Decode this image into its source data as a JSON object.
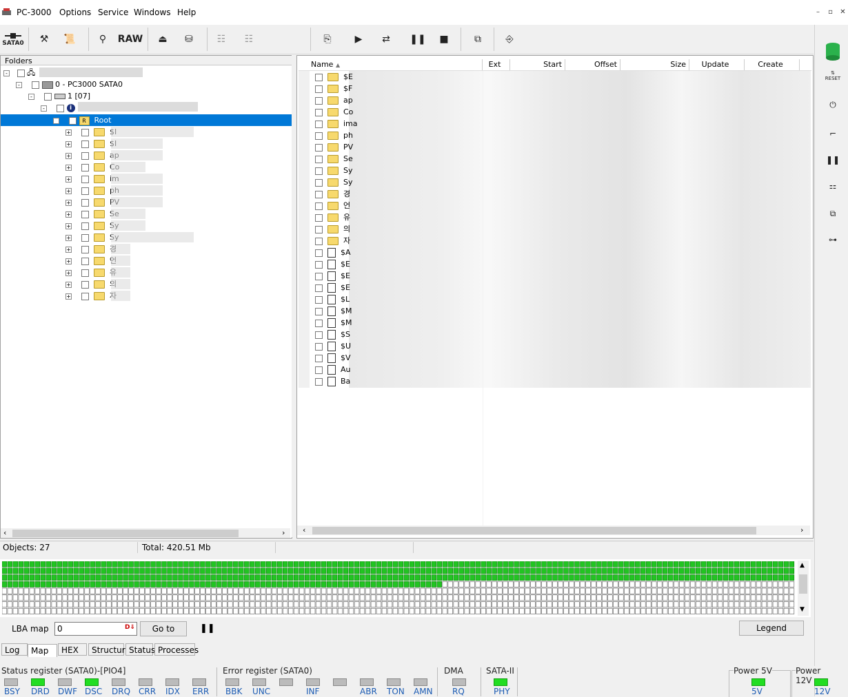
{
  "app": {
    "title": "PC-3000",
    "menu": [
      "Options",
      "Service",
      "Windows",
      "Help"
    ]
  },
  "toolbar": {
    "sata_label": "SATA0",
    "raw_label": "RAW"
  },
  "folders": {
    "header": "Folders",
    "tree": [
      {
        "label": "0 - PC3000 SATA0"
      },
      {
        "label": "1 [07]"
      },
      {
        "label": "Root"
      }
    ],
    "children": [
      "$I",
      "$I",
      "ap",
      "Co",
      "im",
      "ph",
      "PV",
      "Se",
      "Sy",
      "Sy",
      "경",
      "언",
      "유",
      "의",
      "자"
    ]
  },
  "filelist": {
    "columns": [
      "Name",
      "Ext",
      "Start",
      "Offset",
      "Size",
      "Update",
      "Create"
    ],
    "folders": [
      "$E",
      "$F",
      "ap",
      "Co",
      "ima",
      "ph",
      "PV",
      "Se",
      "Sy",
      "Sy",
      "경",
      "언",
      "유",
      "의",
      "자"
    ],
    "files": [
      "$A",
      "$E",
      "$E",
      "$E",
      "$L",
      "$M",
      "$M",
      "$S",
      "$U",
      "$V",
      "Au",
      "Ba"
    ]
  },
  "status": {
    "objects": "Objects: 27",
    "total": "Total: 420.51 Mb"
  },
  "map": {
    "lba_label": "LBA map",
    "lba_value": "0",
    "goto_label": "Go to",
    "legend_label": "Legend",
    "green_rows_full": 3,
    "green_cells_row4": 80
  },
  "tabs": [
    "Log",
    "Map",
    "HEX",
    "Structure",
    "Status",
    "Processes"
  ],
  "registers": {
    "status_title": "Status register (SATA0)-[PIO4]",
    "status_leds": [
      {
        "n": "BSY",
        "on": false
      },
      {
        "n": "DRD",
        "on": true
      },
      {
        "n": "DWF",
        "on": false
      },
      {
        "n": "DSC",
        "on": true
      },
      {
        "n": "DRQ",
        "on": false
      },
      {
        "n": "CRR",
        "on": false
      },
      {
        "n": "IDX",
        "on": false
      },
      {
        "n": "ERR",
        "on": false
      }
    ],
    "error_title": "Error register (SATA0)",
    "error_leds": [
      {
        "n": "BBK",
        "on": false
      },
      {
        "n": "UNC",
        "on": false
      },
      {
        "n": "",
        "on": false
      },
      {
        "n": "INF",
        "on": false
      },
      {
        "n": "",
        "on": false
      },
      {
        "n": "ABR",
        "on": false
      },
      {
        "n": "TON",
        "on": false
      },
      {
        "n": "AMN",
        "on": false
      }
    ],
    "dma_title": "DMA",
    "dma_led": "RQ",
    "sata_title": "SATA-II",
    "sata_led": "PHY",
    "p5_title": "Power 5V",
    "p5_led": "5V",
    "p12_title": "Power 12V",
    "p12_led": "12V"
  },
  "colors": {
    "selection": "#0078d7",
    "led_on": "#22dd22",
    "map_green": "#22c422"
  }
}
